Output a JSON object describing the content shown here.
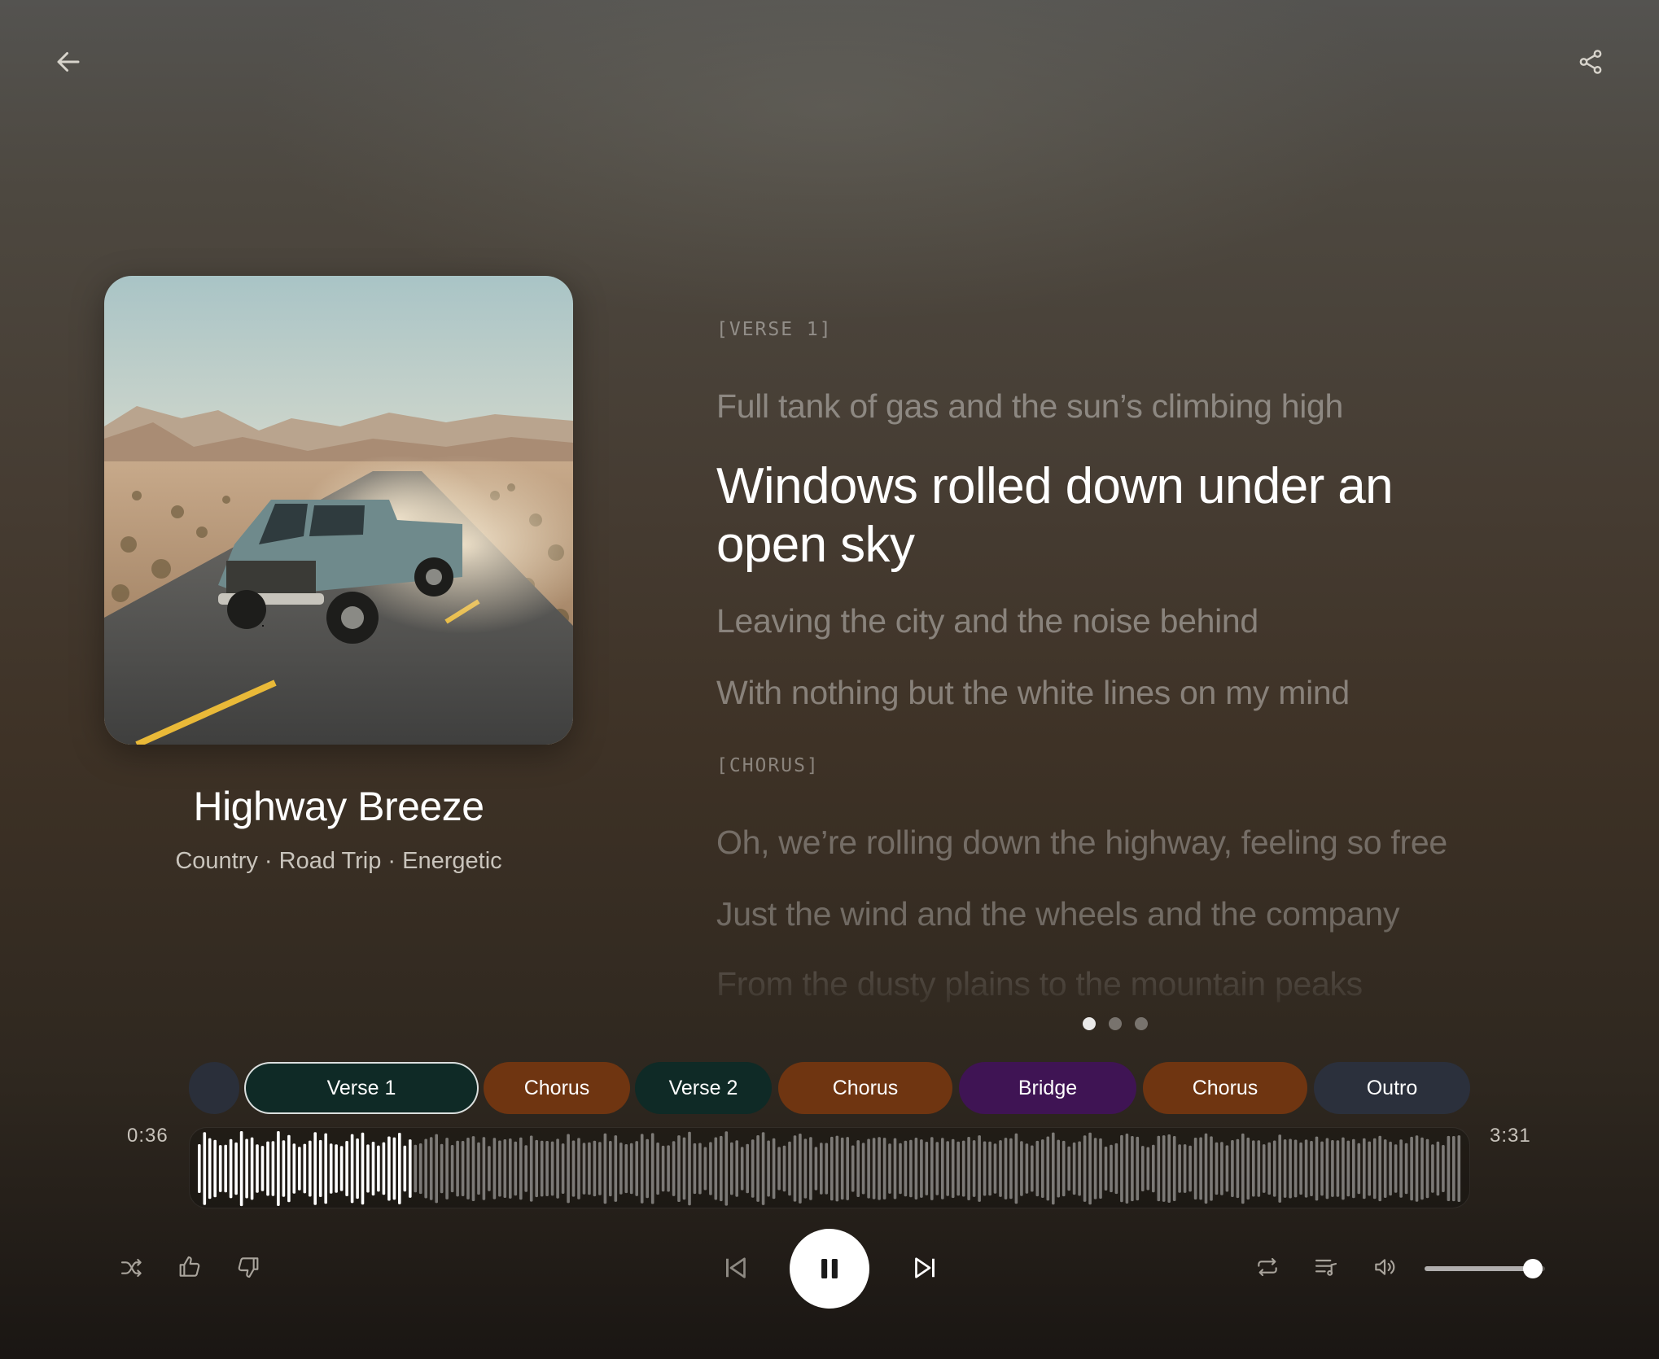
{
  "song": {
    "title": "Highway Breeze",
    "tags": "Country · Road Trip · Energetic"
  },
  "lyrics": [
    {
      "kind": "section",
      "text": "[VERSE 1]"
    },
    {
      "kind": "line",
      "text": "Full tank of gas and the sun’s climbing high",
      "state": "past"
    },
    {
      "kind": "line",
      "text": "Windows rolled down under an open sky",
      "state": "active"
    },
    {
      "kind": "line",
      "text": "Leaving the city and the noise behind",
      "state": "upcoming"
    },
    {
      "kind": "line",
      "text": "With nothing but the white lines on my mind",
      "state": "upcoming"
    },
    {
      "kind": "section",
      "text": "[CHORUS]"
    },
    {
      "kind": "line",
      "text": "Oh, we’re rolling down the highway, feeling so free",
      "state": "later"
    },
    {
      "kind": "line",
      "text": "Just the wind and the wheels and the company",
      "state": "later"
    },
    {
      "kind": "line",
      "text": "From the dusty plains to the mountain peaks",
      "state": "later"
    }
  ],
  "pager": {
    "pages": 3,
    "current": 0
  },
  "sections": [
    {
      "label": "",
      "color": "#2a2f3a",
      "active": false
    },
    {
      "label": "Verse 1",
      "color": "#0f2a26",
      "active": true
    },
    {
      "label": "Chorus",
      "color": "#6f3511",
      "active": false
    },
    {
      "label": "Verse 2",
      "color": "#0f2a26",
      "active": false
    },
    {
      "label": "Chorus",
      "color": "#6f3511",
      "active": false
    },
    {
      "label": "Bridge",
      "color": "#3f1454",
      "active": false
    },
    {
      "label": "Chorus",
      "color": "#6f3511",
      "active": false
    },
    {
      "label": "Outro",
      "color": "#2b303c",
      "active": false
    }
  ],
  "player": {
    "elapsed": "0:36",
    "duration": "3:31",
    "progress": 0.17,
    "volume": 0.9,
    "state": "playing"
  },
  "icons": {
    "back": "arrow-left-icon",
    "share": "share-icon",
    "shuffle": "shuffle-icon",
    "like": "thumbs-up-icon",
    "dislike": "thumbs-down-icon",
    "previous": "skip-previous-icon",
    "play_pause": "pause-icon",
    "next": "skip-next-icon",
    "repeat": "repeat-icon",
    "queue": "queue-icon",
    "volume": "volume-icon"
  }
}
